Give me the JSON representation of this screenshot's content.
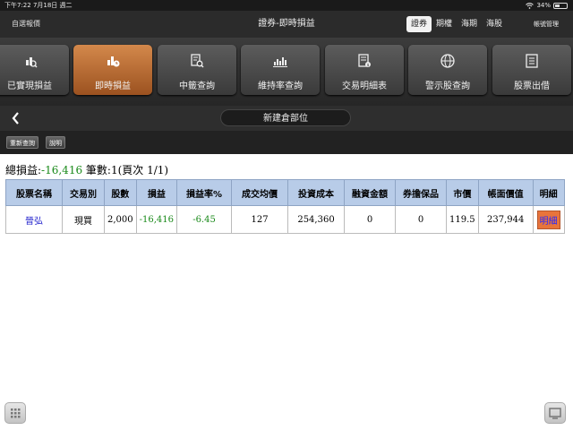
{
  "status_bar": {
    "time_date": "下午7:22   7月18日 週二",
    "battery": "34%"
  },
  "header": {
    "left_label": "自選報價",
    "title": "證券-即時損益",
    "segments": [
      "證券",
      "期權",
      "海期",
      "海股"
    ],
    "active_segment": "證券",
    "account_button": "帳號管理"
  },
  "toolbar": {
    "items": [
      {
        "label": "已實現損益",
        "icon": "chart-magnify-icon",
        "active": false
      },
      {
        "label": "即時損益",
        "icon": "chart-clock-icon",
        "active": true
      },
      {
        "label": "中籤查詢",
        "icon": "document-search-icon",
        "active": false
      },
      {
        "label": "維持率查詢",
        "icon": "bar-chart-icon",
        "active": false
      },
      {
        "label": "交易明細表",
        "icon": "list-dollar-icon",
        "active": false
      },
      {
        "label": "警示股查詢",
        "icon": "globe-icon",
        "active": false
      },
      {
        "label": "股票出借",
        "icon": "list-icon",
        "active": false
      }
    ]
  },
  "subbar": {
    "back_icon": "chevron-left-icon",
    "title": "新建倉部位"
  },
  "buttons": {
    "refresh": "重新查詢",
    "help": "說明"
  },
  "summary": {
    "total_label": "總損益:",
    "total_value": "-16,416",
    "count_text": "筆數:1(頁次 1/1)"
  },
  "table": {
    "headers": [
      "股票名稱",
      "交易別",
      "股數",
      "損益",
      "損益率%",
      "成交均價",
      "投資成本",
      "融資金額",
      "券擔保品",
      "市價",
      "帳面價值",
      "明細"
    ],
    "rows": [
      [
        "晉弘",
        "現買",
        "2,000",
        "-16,416",
        "-6.45",
        "127",
        "254,360",
        "0",
        "0",
        "119.5",
        "237,944",
        "明細"
      ]
    ]
  },
  "colors": {
    "accent_active": "#c47335",
    "table_header": "#b8cce8",
    "loss_green": "#1a8a1a",
    "stock_link": "#2222cc"
  }
}
